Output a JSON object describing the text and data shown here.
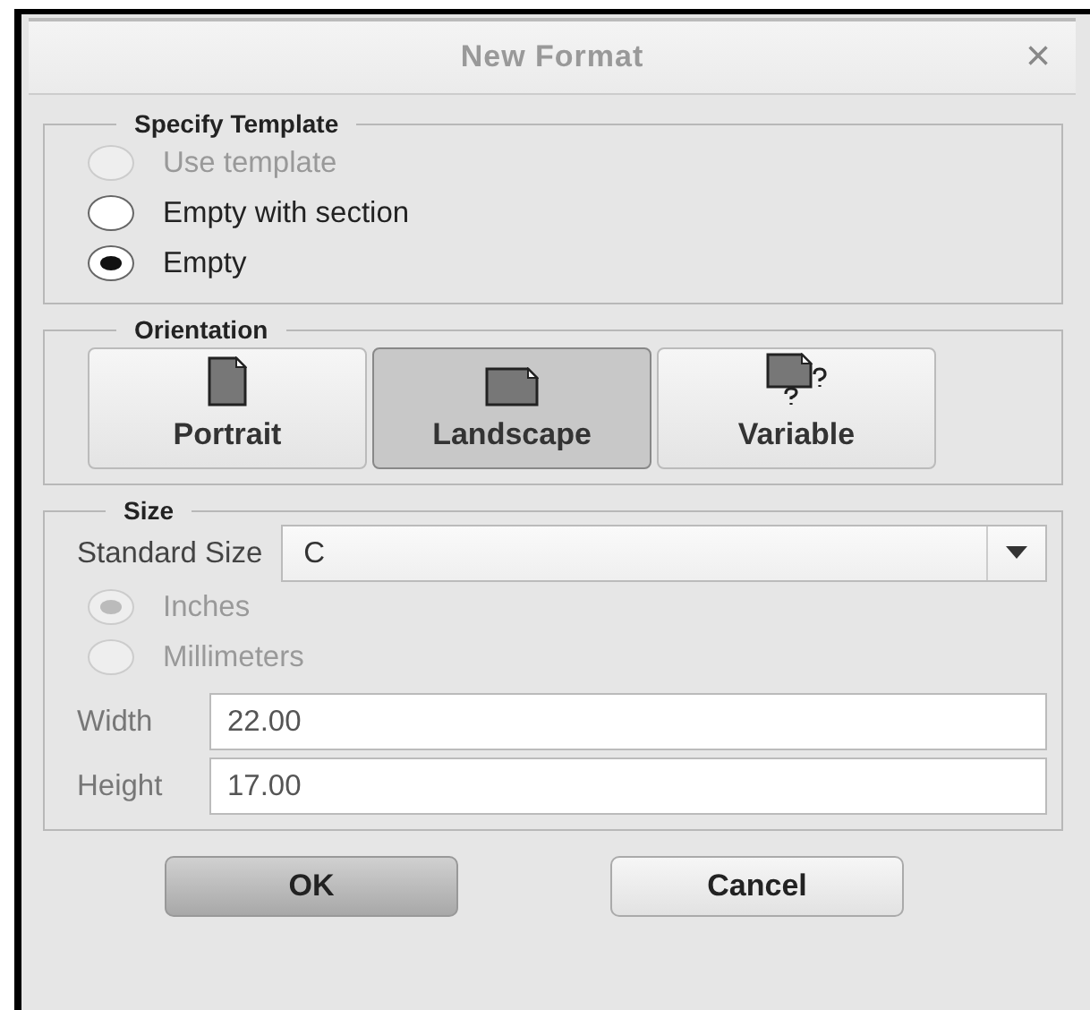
{
  "window": {
    "title": "New Format",
    "close": "×"
  },
  "template": {
    "legend": "Specify Template",
    "options": [
      {
        "label": "Use template",
        "selected": false,
        "disabled": true
      },
      {
        "label": "Empty with section",
        "selected": false,
        "disabled": false
      },
      {
        "label": "Empty",
        "selected": true,
        "disabled": false
      }
    ]
  },
  "orientation": {
    "legend": "Orientation",
    "options": [
      {
        "label": "Portrait",
        "kind": "portrait",
        "selected": false
      },
      {
        "label": "Landscape",
        "kind": "landscape",
        "selected": true
      },
      {
        "label": "Variable",
        "kind": "variable",
        "selected": false
      }
    ]
  },
  "size": {
    "legend": "Size",
    "standard_size": {
      "label": "Standard Size",
      "value": "C"
    },
    "units": [
      {
        "label": "Inches",
        "selected": true,
        "disabled": true
      },
      {
        "label": "Millimeters",
        "selected": false,
        "disabled": true
      }
    ],
    "fields": [
      {
        "label": "Width",
        "value": "22.00"
      },
      {
        "label": "Height",
        "value": "17.00"
      }
    ]
  },
  "buttons": [
    {
      "label": "OK",
      "default": true
    },
    {
      "label": "Cancel",
      "default": false
    }
  ]
}
